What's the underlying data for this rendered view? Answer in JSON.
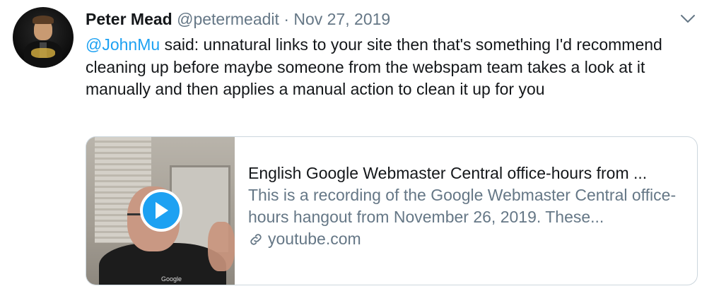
{
  "tweet": {
    "author_name": "Peter Mead",
    "author_handle": "@petermeadit",
    "separator": "·",
    "date": "Nov 27, 2019",
    "mention": "@JohnMu",
    "body": " said: unnatural links to your site then that's something I'd recommend cleaning up before maybe someone from the webspam team takes a look at it manually and then applies a manual action to clean it up for you",
    "card": {
      "title": "English Google Webmaster Central office-hours from ...",
      "description": "This is a recording of the Google Webmaster Central office-hours hangout from November 26, 2019. These...",
      "domain": "youtube.com",
      "thumbnail_logo_text": "Google"
    }
  },
  "icons": {
    "caret": "chevron-down-icon",
    "play": "play-icon",
    "link": "link-icon"
  },
  "colors": {
    "accent": "#1da1f2",
    "text": "#14171a",
    "secondary": "#657786",
    "border": "#ccd6dd"
  }
}
